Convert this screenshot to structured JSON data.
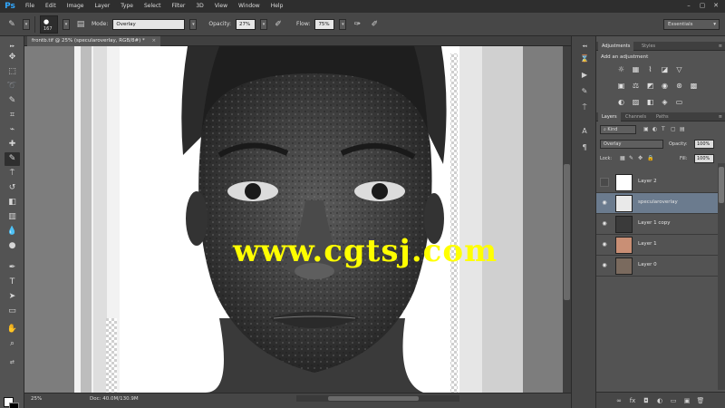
{
  "app": {
    "logo": "Ps"
  },
  "menu": [
    "File",
    "Edit",
    "Image",
    "Layer",
    "Type",
    "Select",
    "Filter",
    "3D",
    "View",
    "Window",
    "Help"
  ],
  "window_controls": [
    "–",
    "▢",
    "✕"
  ],
  "options_bar": {
    "brush_size": "167",
    "mode_label": "Mode:",
    "mode_value": "Overlay",
    "opacity_label": "Opacity:",
    "opacity_value": "27%",
    "flow_label": "Flow:",
    "flow_value": "75%",
    "workspace": "Essentials"
  },
  "document": {
    "tab_title": "frontb.tif @ 25% (specularoverlay, RGB/8#) *",
    "tab_close": "×",
    "zoom": "25%",
    "doc_size": "Doc: 40.0M/130.9M"
  },
  "watermark": "www.cgtsj.com",
  "panels": {
    "adjustments_tabs": [
      "Adjustments",
      "Styles"
    ],
    "adjustments_title": "Add an adjustment",
    "layers_tabs": [
      "Layers",
      "Channels",
      "Paths"
    ],
    "filter_kind": "Kind",
    "blend_mode": "Overlay",
    "opacity_label": "Opacity:",
    "opacity_value": "100%",
    "lock_label": "Lock:",
    "fill_label": "Fill:",
    "fill_value": "100%",
    "layers": [
      {
        "name": "Layer 2",
        "visible": false,
        "selected": false
      },
      {
        "name": "specularoverlay",
        "visible": true,
        "selected": true
      },
      {
        "name": "Layer 1 copy",
        "visible": true,
        "selected": false
      },
      {
        "name": "Layer 1",
        "visible": true,
        "selected": false
      },
      {
        "name": "Layer 0",
        "visible": true,
        "selected": false
      }
    ]
  },
  "colors": {
    "selected_layer": "#6b7b8e",
    "watermark": "#ffff00",
    "foreground": "#ffffff",
    "background": "#000000"
  }
}
